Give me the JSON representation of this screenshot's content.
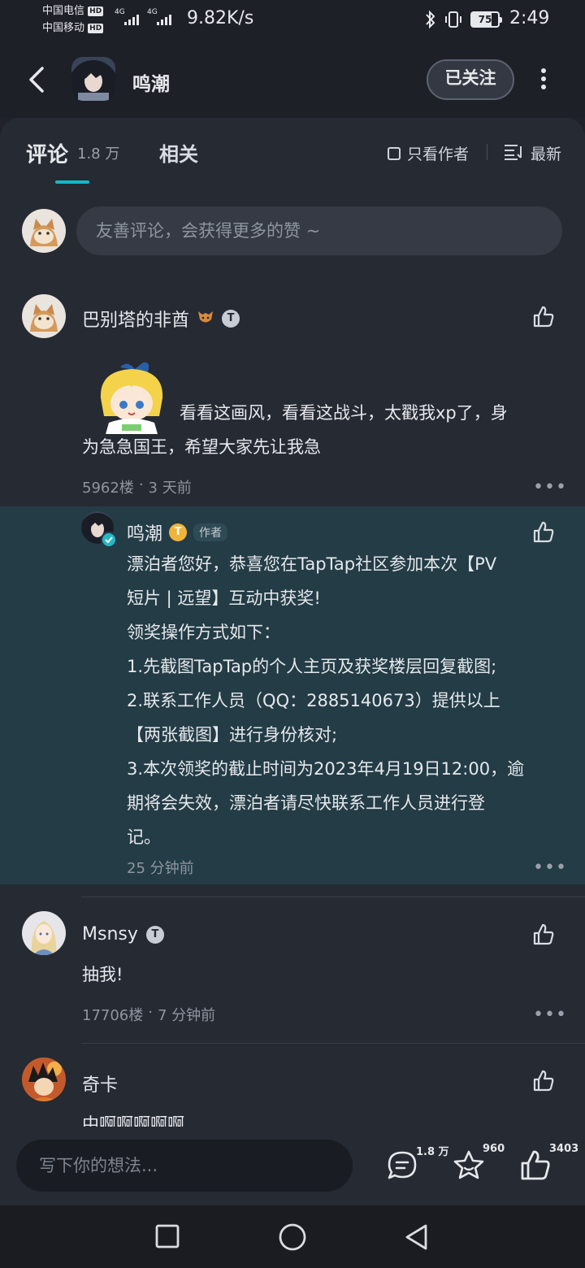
{
  "status_bar": {
    "carrier1": "中国电信",
    "carrier2": "中国移动",
    "hd": "HD",
    "net1": "4G",
    "net2": "4G",
    "speed": "9.82K/s",
    "battery": "75",
    "time": "2:49"
  },
  "header": {
    "title": "鸣潮",
    "follow_label": "已关注"
  },
  "tabs": {
    "comments_label": "评论",
    "comments_count": "1.8 万",
    "related_label": "相关",
    "author_only_label": "只看作者",
    "sort_label": "最新"
  },
  "comment_input": {
    "placeholder": "友善评论，会获得更多的赞 ~"
  },
  "comments": [
    {
      "user": "巴别塔的非酋",
      "text_line1": "看看这画风，看看这战斗，太戳我xp了，身",
      "text_line2": "为急急国王，希望大家先让我急",
      "floor": "5962楼",
      "time": "3 天前"
    },
    {
      "user": "Msnsy",
      "text": "抽我!",
      "floor": "17706楼",
      "time": "7 分钟前"
    },
    {
      "user": "奇卡",
      "text": "中啊啊啊啊啊"
    }
  ],
  "reply": {
    "user": "鸣潮",
    "author_tag": "作者",
    "lines": [
      "漂泊者您好，恭喜您在TapTap社区参加本次【PV",
      "短片 | 远望】互动中获奖!",
      "领奖操作方式如下：",
      "1.先截图TapTap的个人主页及获奖楼层回复截图;",
      "2.联系工作人员（QQ：2885140673）提供以上",
      "【两张截图】进行身份核对;",
      "3.本次领奖的截止时间为2023年4月19日12:00，逾",
      "期将会失效，漂泊者请尽快联系工作人员进行登",
      "记。"
    ],
    "time": "25 分钟前"
  },
  "bottom_bar": {
    "placeholder": "写下你的想法...",
    "comment_count": "1.8 万",
    "favorite_count": "960",
    "like_count": "3403"
  },
  "badge_letter": "T",
  "more_dots": "•••",
  "meta_sep": "·",
  "colors": {
    "accent": "#14b8c8",
    "panel_bg": "#262a33",
    "reply_bg": "#233c46",
    "page_bg": "#1f222a"
  },
  "icons": [
    "back-icon",
    "more-vertical-icon",
    "checkbox-icon",
    "sort-icon",
    "thumb-up-icon",
    "comment-icon",
    "star-icon",
    "square-nav-icon",
    "circle-nav-icon",
    "triangle-nav-icon",
    "verified-icon"
  ]
}
